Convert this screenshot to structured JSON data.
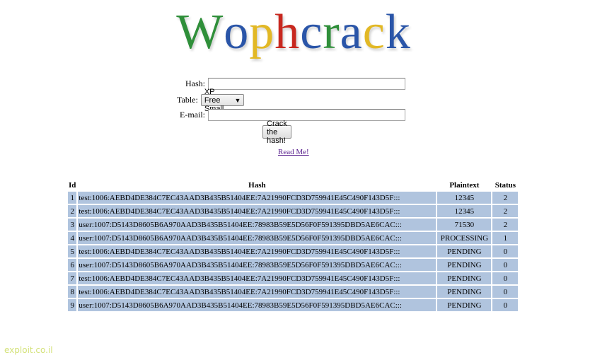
{
  "logo": {
    "letters": [
      {
        "char": "W",
        "color": "#2f8f3a"
      },
      {
        "char": "o",
        "color": "#2a55a8"
      },
      {
        "char": "p",
        "color": "#e2b825"
      },
      {
        "char": "h",
        "color": "#c8281f"
      },
      {
        "char": "c",
        "color": "#2a55a8"
      },
      {
        "char": "r",
        "color": "#2f8f3a"
      },
      {
        "char": "a",
        "color": "#2a55a8"
      },
      {
        "char": "c",
        "color": "#e2b825"
      },
      {
        "char": "k",
        "color": "#2a55a8"
      }
    ]
  },
  "form": {
    "hash_label": "Hash:",
    "hash_value": "",
    "table_label": "Table:",
    "table_selected": "XP Free Small",
    "email_label": "E-mail:",
    "email_value": "",
    "submit_label": "Crack the hash!"
  },
  "readme_link": "Read Me!",
  "table": {
    "headers": {
      "id": "Id",
      "hash": "Hash",
      "plaintext": "Plaintext",
      "status": "Status"
    },
    "row_color": "#b0c4de",
    "rows": [
      {
        "id": "1",
        "hash": "test:1006:AEBD4DE384C7EC43AAD3B435B51404EE:7A21990FCD3D759941E45C490F143D5F:::",
        "plaintext": "12345",
        "status": "2"
      },
      {
        "id": "2",
        "hash": "test:1006:AEBD4DE384C7EC43AAD3B435B51404EE:7A21990FCD3D759941E45C490F143D5F:::",
        "plaintext": "12345",
        "status": "2"
      },
      {
        "id": "3",
        "hash": "user:1007:D5143D8605B6A970AAD3B435B51404EE:78983B59E5D56F0F591395DBD5AE6CAC:::",
        "plaintext": "71530",
        "status": "2"
      },
      {
        "id": "4",
        "hash": "user:1007:D5143D8605B6A970AAD3B435B51404EE:78983B59E5D56F0F591395DBD5AE6CAC:::",
        "plaintext": "PROCESSING",
        "status": "1"
      },
      {
        "id": "5",
        "hash": "test:1006:AEBD4DE384C7EC43AAD3B435B51404EE:7A21990FCD3D759941E45C490F143D5F:::",
        "plaintext": "PENDING",
        "status": "0"
      },
      {
        "id": "6",
        "hash": "user:1007:D5143D8605B6A970AAD3B435B51404EE:78983B59E5D56F0F591395DBD5AE6CAC:::",
        "plaintext": "PENDING",
        "status": "0"
      },
      {
        "id": "7",
        "hash": "test:1006:AEBD4DE384C7EC43AAD3B435B51404EE:7A21990FCD3D759941E45C490F143D5F:::",
        "plaintext": "PENDING",
        "status": "0"
      },
      {
        "id": "8",
        "hash": "test:1006:AEBD4DE384C7EC43AAD3B435B51404EE:7A21990FCD3D759941E45C490F143D5F:::",
        "plaintext": "PENDING",
        "status": "0"
      },
      {
        "id": "9",
        "hash": "user:1007:D5143D8605B6A970AAD3B435B51404EE:78983B59E5D56F0F591395DBD5AE6CAC:::",
        "plaintext": "PENDING",
        "status": "0"
      }
    ]
  },
  "footer": {
    "text": "exploit.co.il",
    "color": "#d4e27a"
  }
}
